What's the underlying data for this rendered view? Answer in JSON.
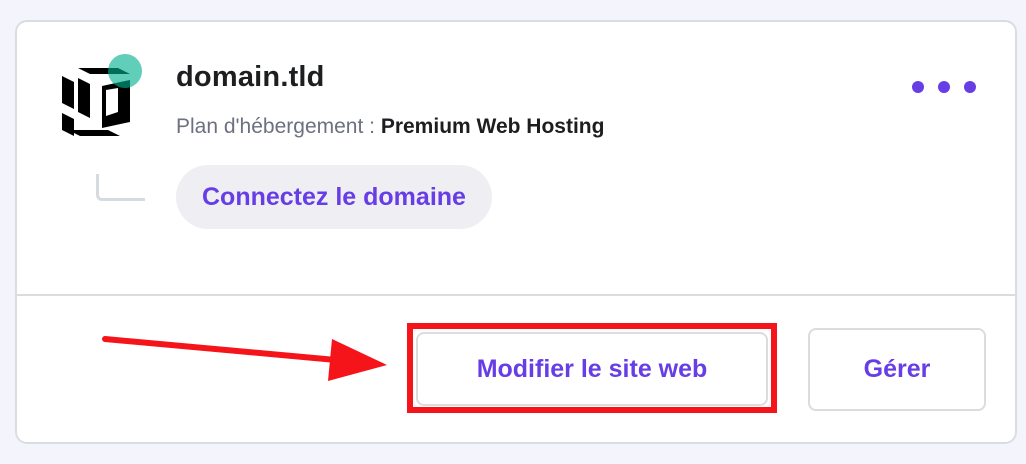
{
  "card": {
    "domain_title": "domain.tld",
    "plan_label": "Plan d'hébergement :",
    "plan_name": "Premium Web Hosting",
    "connect_domain_label": "Connectez le domaine",
    "more_menu_icon": "more-horizontal-icon",
    "logo_icon": "hostinger-logo-icon",
    "status_color": "#00b090"
  },
  "actions": {
    "edit_website_label": "Modifier le site web",
    "manage_label": "Gérer"
  },
  "annotation": {
    "arrow_icon": "red-arrow-icon",
    "highlight_color": "#f5141a"
  },
  "colors": {
    "accent": "#673de6",
    "text_dark": "#1d1e20",
    "text_muted": "#6d7081"
  }
}
